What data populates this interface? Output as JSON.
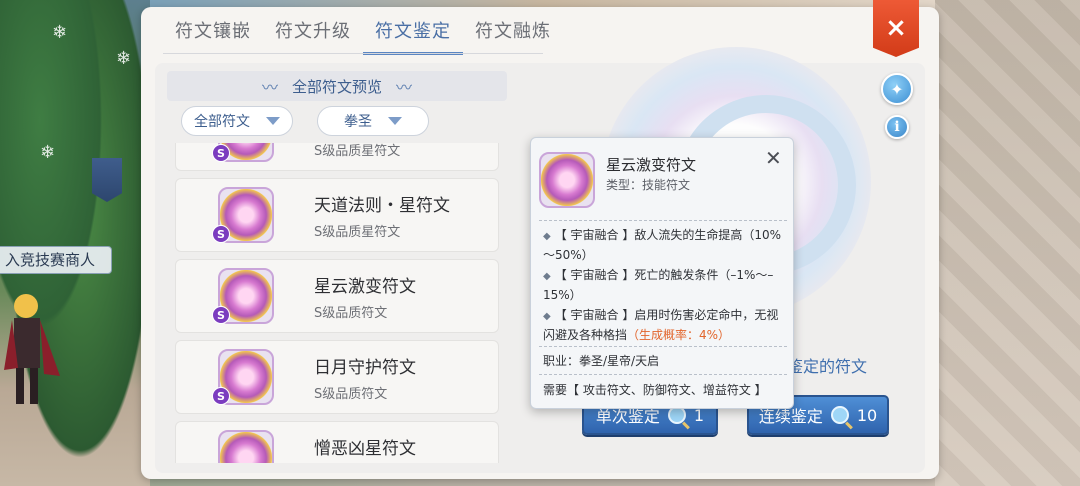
{
  "scene": {
    "npc_tag": "入竞技赛商人"
  },
  "tabs": [
    {
      "label": "符文镶嵌",
      "active": false
    },
    {
      "label": "符文升级",
      "active": false
    },
    {
      "label": "符文鉴定",
      "active": true
    },
    {
      "label": "符文融炼",
      "active": false
    }
  ],
  "close_icon": "×",
  "list": {
    "header": "全部符文预览",
    "header_deco": "〰",
    "filters": [
      {
        "label": "全部符文"
      },
      {
        "label": "拳圣"
      }
    ],
    "badge_letter": "S",
    "items": [
      {
        "name": "",
        "quality": "S级品质星符文"
      },
      {
        "name": "天道法则・星符文",
        "quality": "S级品质星符文"
      },
      {
        "name": "星云激变符文",
        "quality": "S级品质符文"
      },
      {
        "name": "日月守护符文",
        "quality": "S级品质符文"
      },
      {
        "name": "憎恶凶星符文",
        "quality": ""
      }
    ]
  },
  "tooltip": {
    "title": "星云激变符文",
    "type": "类型：技能符文",
    "close": "✕",
    "effects": [
      {
        "text": "【 宇宙融合 】敌人流失的生命提高（10%～50%）",
        "highlight": ""
      },
      {
        "text": "【 宇宙融合 】死亡的触发条件（–1%～–15%）",
        "highlight": ""
      },
      {
        "text": "【 宇宙融合 】启用时伤害必定命中，无视闪避及各种格挡",
        "highlight": "（生成概率：4%）"
      }
    ],
    "job": "职业：拳圣/星帝/天启",
    "requirement": "需要【 攻击符文、防御符文、增益符文 】"
  },
  "prompt_text": "鉴定的符文",
  "buttons": {
    "single": {
      "label": "单次鉴定",
      "count": "1"
    },
    "multi": {
      "label": "连续鉴定",
      "count": "10"
    }
  },
  "icons": {
    "wand": "magic-wand-icon",
    "info": "i"
  },
  "colors": {
    "accent_blue": "#4a6fa5",
    "close_red": "#d23b18",
    "probability_orange": "#e2652c"
  }
}
